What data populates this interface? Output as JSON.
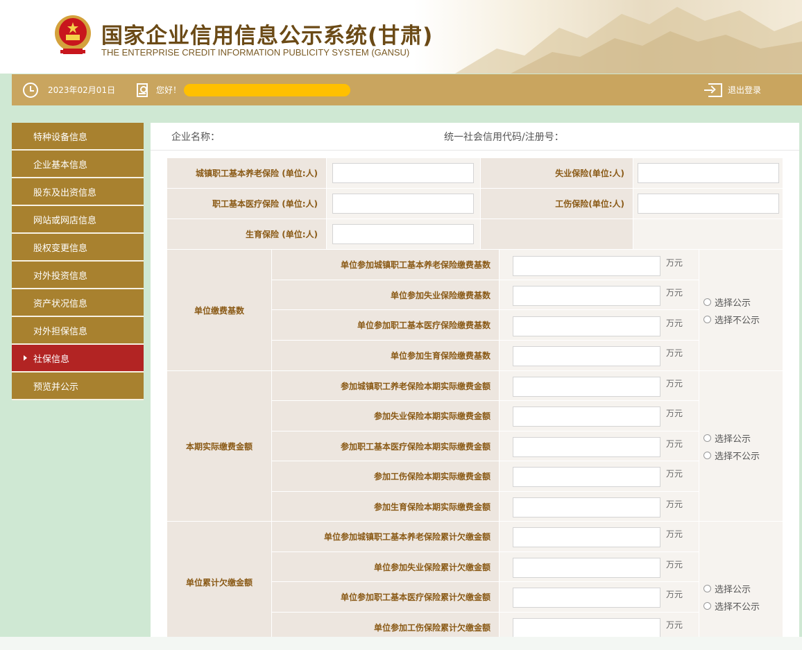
{
  "header": {
    "title_cn": "国家企业信用信息公示系统(甘肃)",
    "title_en": "THE ENTERPRISE CREDIT INFORMATION PUBLICITY SYSTEM (GANSU)"
  },
  "toolbar": {
    "date": "2023年02月01日",
    "greeting": "您好！",
    "logout": "退出登录"
  },
  "sidebar": {
    "items": [
      {
        "label": "特种设备信息"
      },
      {
        "label": "企业基本信息"
      },
      {
        "label": "股东及出资信息"
      },
      {
        "label": "网站或网店信息"
      },
      {
        "label": "股权变更信息"
      },
      {
        "label": "对外投资信息"
      },
      {
        "label": "资产状况信息"
      },
      {
        "label": "对外担保信息"
      },
      {
        "label": "社保信息"
      },
      {
        "label": "预览并公示"
      }
    ]
  },
  "company": {
    "name_label": "企业名称：",
    "code_label": "统一社会信用代码/注册号："
  },
  "insurance": {
    "pension": "城镇职工基本养老保险 (单位:人)",
    "unemployment": "失业保险(单位:人)",
    "medical": "职工基本医疗保险 (单位:人)",
    "injury": "工伤保险(单位:人)",
    "maternity": "生育保险 (单位:人)"
  },
  "unit": "万元",
  "radio_public": "选择公示",
  "radio_private": "选择不公示",
  "groups": [
    {
      "title": "单位缴费基数",
      "rows": [
        "单位参加城镇职工基本养老保险缴费基数",
        "单位参加失业保险缴费基数",
        "单位参加职工基本医疗保险缴费基数",
        "单位参加生育保险缴费基数"
      ]
    },
    {
      "title": "本期实际缴费金额",
      "rows": [
        "参加城镇职工养老保险本期实际缴费金额",
        "参加失业保险本期实际缴费金额",
        "参加职工基本医疗保险本期实际缴费金额",
        "参加工伤保险本期实际缴费金额",
        "参加生育保险本期实际缴费金额"
      ]
    },
    {
      "title": "单位累计欠缴金额",
      "rows": [
        "单位参加城镇职工基本养老保险累计欠缴金额",
        "单位参加失业保险累计欠缴金额",
        "单位参加职工基本医疗保险累计欠缴金额",
        "单位参加工伤保险累计欠缴金额"
      ]
    }
  ]
}
